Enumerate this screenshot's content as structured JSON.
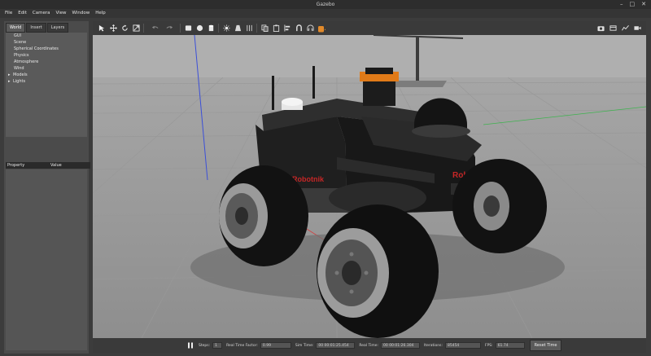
{
  "window": {
    "title": "Gazebo",
    "controls": [
      "–",
      "□",
      "✕"
    ]
  },
  "menu": [
    "File",
    "Edit",
    "Camera",
    "View",
    "Window",
    "Help"
  ],
  "left_panel": {
    "tabs": [
      {
        "label": "World",
        "active": true
      },
      {
        "label": "Insert",
        "active": false
      },
      {
        "label": "Layers",
        "active": false
      }
    ],
    "tree": [
      {
        "label": "GUI",
        "expandable": false
      },
      {
        "label": "Scene",
        "expandable": false
      },
      {
        "label": "Spherical Coordinates",
        "expandable": false
      },
      {
        "label": "Physics",
        "expandable": false
      },
      {
        "label": "Atmosphere",
        "expandable": false
      },
      {
        "label": "Wind",
        "expandable": false
      },
      {
        "label": "Models",
        "expandable": true
      },
      {
        "label": "Lights",
        "expandable": true
      }
    ],
    "properties": {
      "col_property": "Property",
      "col_value": "Value"
    }
  },
  "toolbar": {
    "left_icons": [
      "select-arrow-icon",
      "translate-icon",
      "rotate-icon",
      "scale-icon",
      "undo-icon",
      "redo-icon",
      "box-icon",
      "sphere-icon",
      "cylinder-icon",
      "point-light-icon",
      "spot-light-icon",
      "directional-light-icon",
      "copy-icon",
      "paste-icon",
      "align-icon",
      "snap-icon",
      "audio-icon",
      "hand-view-icon"
    ],
    "right_icons": [
      "screenshot-icon",
      "record-icon",
      "plot-icon",
      "video-icon"
    ]
  },
  "status_bar": {
    "steps_label": "Steps:",
    "steps_value": "1",
    "rtf_label": "Real Time Factor:",
    "rtf_value": "0.99",
    "sim_time_label": "Sim Time:",
    "sim_time_value": "00 00:01:25.454",
    "real_time_label": "Real Time:",
    "real_time_value": "00 00:01:26.304",
    "iterations_label": "Iterations:",
    "iterations_value": "85454",
    "fps_label": "FPS:",
    "fps_value": "61.74",
    "reset_label": "Reset Time"
  },
  "robot": {
    "brand_front": "Robotnik",
    "brand_side": "Robotnik"
  },
  "colors": {
    "sky": "#a9a9a9",
    "ground": "#9a9a9a",
    "grid": "#8f8f8f",
    "body": "#1c1c1c",
    "brand": "#c02020"
  }
}
